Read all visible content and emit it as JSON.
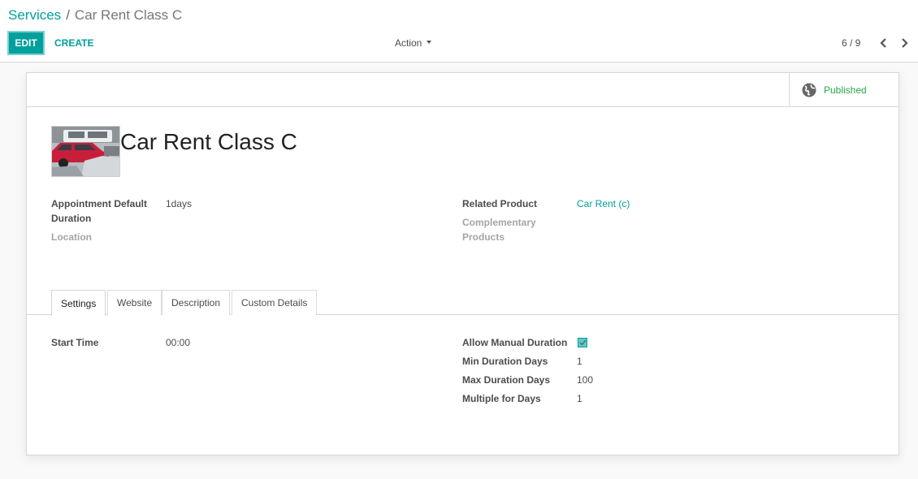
{
  "breadcrumb": {
    "parent": "Services",
    "separator": "/",
    "current": "Car Rent Class C"
  },
  "toolbar": {
    "edit_label": "EDIT",
    "create_label": "CREATE",
    "action_label": "Action"
  },
  "pager": {
    "value": "6 / 9"
  },
  "status_button": {
    "label": "Published",
    "icon": "globe-icon",
    "color": "#28a745"
  },
  "record": {
    "title": "Car Rent Class C",
    "image": "car-photo",
    "fields_left": [
      {
        "label": "Appointment Default Duration",
        "value": "1days"
      },
      {
        "label": "Location",
        "value": ""
      }
    ],
    "fields_right": [
      {
        "label": "Related Product",
        "value": "Car Rent (c)"
      },
      {
        "label": "Complementary Products",
        "value": ""
      }
    ]
  },
  "tabs": [
    {
      "label": "Settings",
      "active": true
    },
    {
      "label": "Website",
      "active": false
    },
    {
      "label": "Description",
      "active": false
    },
    {
      "label": "Custom Details",
      "active": false
    }
  ],
  "settings": {
    "left": [
      {
        "label": "Start Time",
        "value": "00:00"
      }
    ],
    "right": [
      {
        "label": "Allow Manual Duration",
        "value": true
      },
      {
        "label": "Min Duration Days",
        "value": "1"
      },
      {
        "label": "Max Duration Days",
        "value": "100"
      },
      {
        "label": "Multiple for Days",
        "value": "1"
      }
    ]
  },
  "colors": {
    "accent": "#00a09d",
    "published": "#28a745"
  }
}
